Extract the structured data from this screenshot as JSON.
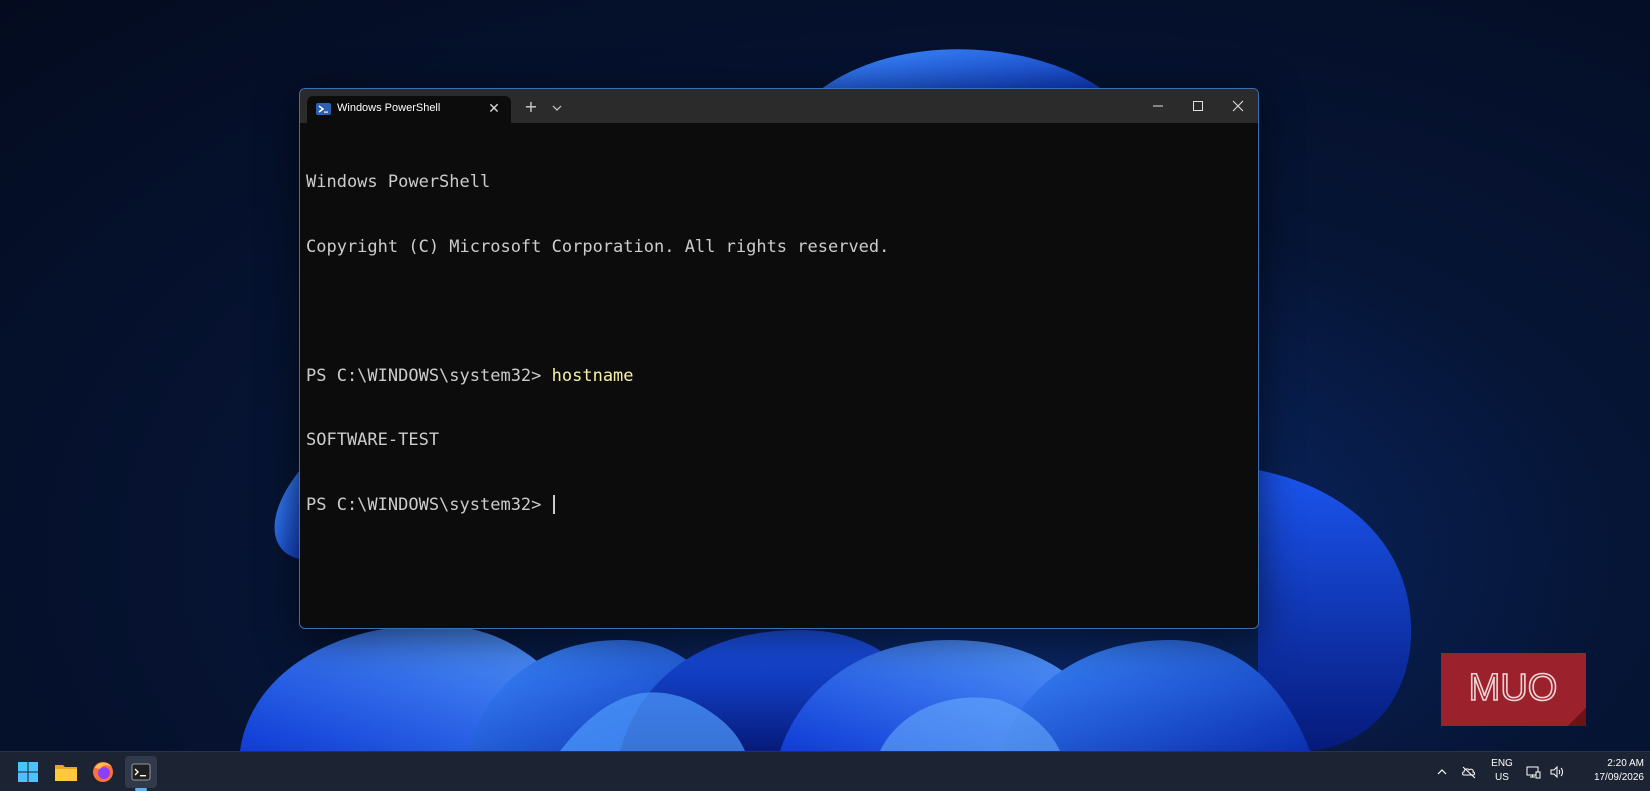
{
  "window": {
    "tab_title": "Windows PowerShell",
    "tab_icon": "powershell-icon",
    "new_tab_symbol": "+",
    "close_symbol": "✕"
  },
  "terminal": {
    "lines": [
      {
        "text": "Windows PowerShell"
      },
      {
        "text": "Copyright (C) Microsoft Corporation. All rights reserved."
      },
      {
        "text": ""
      },
      {
        "prompt": "PS C:\\WINDOWS\\system32> ",
        "command": "hostname"
      },
      {
        "text": "SOFTWARE-TEST"
      },
      {
        "prompt": "PS C:\\WINDOWS\\system32> ",
        "command": ""
      }
    ],
    "text_color": "#cccccc",
    "command_color": "#f9f1a5",
    "background": "#0c0c0c"
  },
  "watermark": {
    "text": "MUO",
    "color": "#a8232b"
  },
  "taskbar": {
    "apps": [
      {
        "name": "start",
        "icon": "windows-logo-icon"
      },
      {
        "name": "file-explorer",
        "icon": "folder-icon"
      },
      {
        "name": "firefox",
        "icon": "firefox-icon"
      },
      {
        "name": "terminal",
        "icon": "terminal-icon",
        "active": true
      }
    ],
    "tray": {
      "lang_line1": "ENG",
      "lang_line2": "US",
      "time": "2:20 AM",
      "date": "17/09/2026"
    },
    "accent": "#5fb2f2"
  }
}
